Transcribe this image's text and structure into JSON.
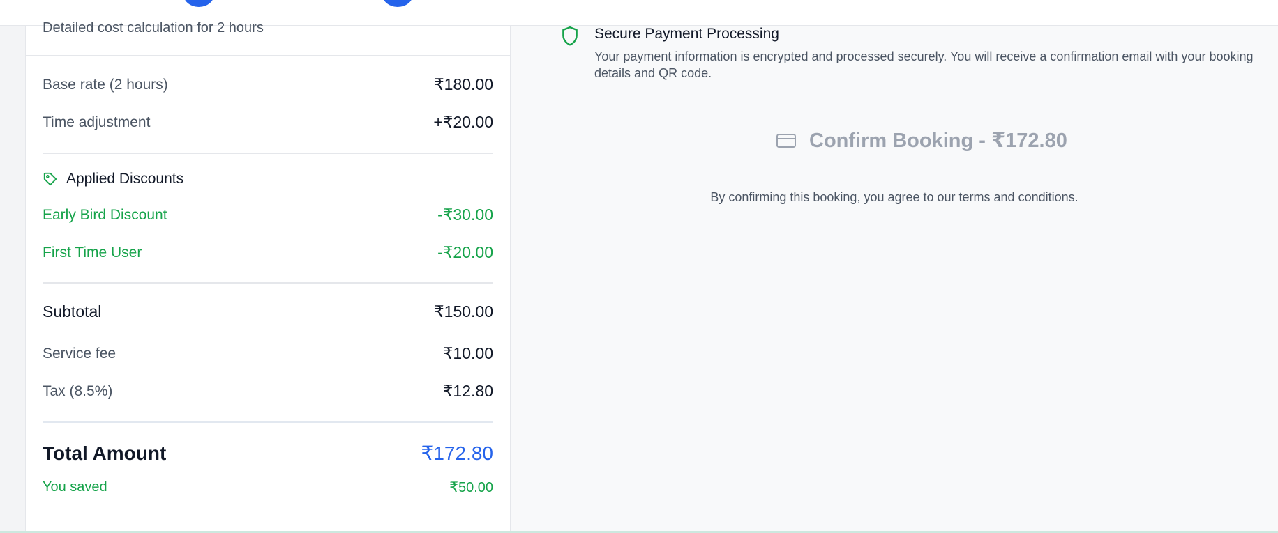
{
  "card": {
    "subtitle": "Detailed cost calculation for 2 hours",
    "rows": [
      {
        "label": "Base rate (2 hours)",
        "value": "₹180.00"
      },
      {
        "label": "Time adjustment",
        "value": "+₹20.00"
      }
    ],
    "discounts": {
      "heading": "Applied Discounts",
      "icon": "tag-icon",
      "items": [
        {
          "label": "Early Bird Discount",
          "value": "-₹30.00"
        },
        {
          "label": "First Time User",
          "value": "-₹20.00"
        }
      ]
    },
    "subtotal": {
      "label": "Subtotal",
      "value": "₹150.00"
    },
    "service_fee": {
      "label": "Service fee",
      "value": "₹10.00"
    },
    "tax": {
      "label": "Tax (8.5%)",
      "value": "₹12.80"
    },
    "total": {
      "label": "Total Amount",
      "value": "₹172.80"
    },
    "saved": {
      "label": "You saved",
      "value": "₹50.00"
    }
  },
  "secure": {
    "icon": "shield-icon",
    "title": "Secure Payment Processing",
    "text": "Your payment information is encrypted and processed securely. You will receive a confirmation email with your booking details and QR code."
  },
  "confirm": {
    "icon": "credit-card-icon",
    "label": "Confirm Booking - ₹172.80"
  },
  "terms": "By confirming this booking, you agree to our terms and conditions.",
  "colors": {
    "accent": "#2563eb",
    "discount": "#16a34a",
    "disabled": "#9ca3af"
  }
}
